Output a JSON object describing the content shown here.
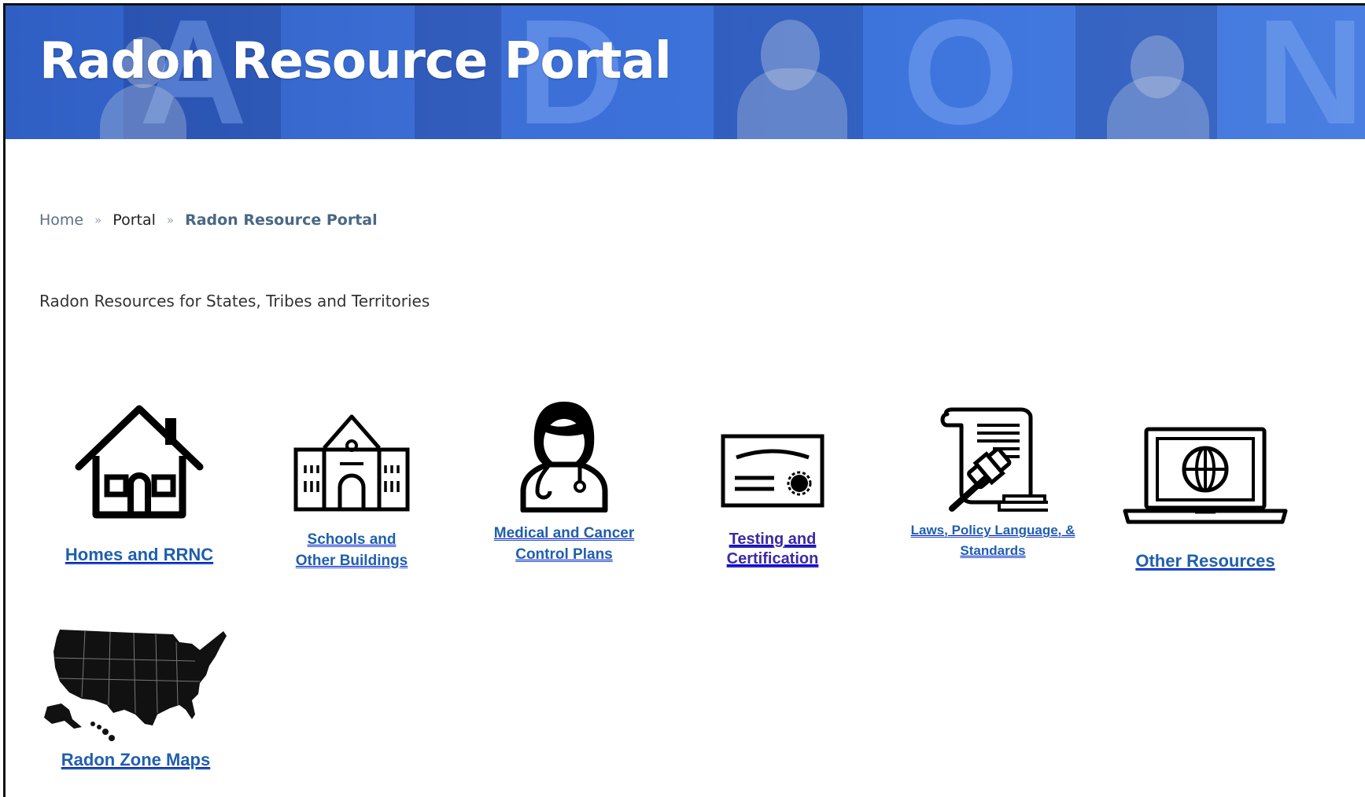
{
  "banner": {
    "title": "Radon Resource Portal",
    "background_letters": [
      "A",
      "D",
      "O",
      "N"
    ],
    "colors": {
      "banner": "#3b6fd8",
      "title": "#ffffff"
    }
  },
  "breadcrumb": {
    "items": [
      "Home",
      "Portal",
      "Radon Resource Portal"
    ],
    "separator": "»"
  },
  "subtitle": "Radon Resources for States, Tribes and Territories",
  "tiles": [
    {
      "icon": "house-icon",
      "label": "Homes and RRNC"
    },
    {
      "icon": "school-building-icon",
      "label_line1": "Schools and",
      "label_line2": "Other Buildings"
    },
    {
      "icon": "doctor-icon",
      "label_line1": "Medical and Cancer",
      "label_line2": "Control Plans"
    },
    {
      "icon": "certificate-icon",
      "label_line1": "Testing and",
      "label_line2": "Certification"
    },
    {
      "icon": "gavel-scroll-icon",
      "label_line1": "Laws, Policy Language, &",
      "label_line2": "Standards"
    },
    {
      "icon": "laptop-globe-icon",
      "label": "Other Resources"
    },
    {
      "icon": "us-map-icon",
      "label": "Radon Zone Maps"
    }
  ],
  "colors": {
    "link": "#1f5fae",
    "visited_link": "#3a2aa6",
    "breadcrumb_current": "#4a6785"
  }
}
